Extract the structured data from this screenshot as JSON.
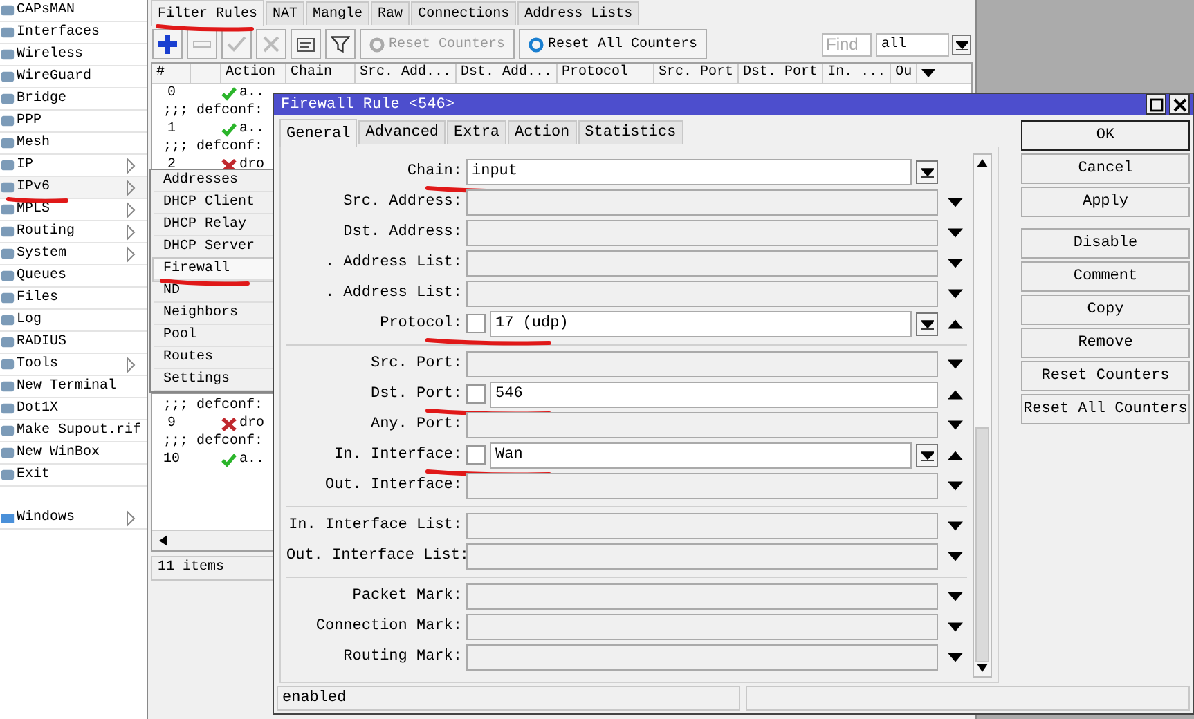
{
  "sidebar": {
    "items": [
      {
        "label": "CAPsMAN",
        "submenu": false,
        "selected": false,
        "underlined": false
      },
      {
        "label": "Interfaces",
        "submenu": false,
        "selected": false,
        "underlined": false
      },
      {
        "label": "Wireless",
        "submenu": false,
        "selected": false,
        "underlined": false
      },
      {
        "label": "WireGuard",
        "submenu": false,
        "selected": false,
        "underlined": false
      },
      {
        "label": "Bridge",
        "submenu": false,
        "selected": false,
        "underlined": false
      },
      {
        "label": "PPP",
        "submenu": false,
        "selected": false,
        "underlined": false
      },
      {
        "label": "Mesh",
        "submenu": false,
        "selected": false,
        "underlined": false
      },
      {
        "label": "IP",
        "submenu": true,
        "selected": false,
        "underlined": false
      },
      {
        "label": "IPv6",
        "submenu": true,
        "selected": true,
        "underlined": true
      },
      {
        "label": "MPLS",
        "submenu": true,
        "selected": false,
        "underlined": false
      },
      {
        "label": "Routing",
        "submenu": true,
        "selected": false,
        "underlined": false
      },
      {
        "label": "System",
        "submenu": true,
        "selected": false,
        "underlined": false
      },
      {
        "label": "Queues",
        "submenu": false,
        "selected": false,
        "underlined": false
      },
      {
        "label": "Files",
        "submenu": false,
        "selected": false,
        "underlined": false
      },
      {
        "label": "Log",
        "submenu": false,
        "selected": false,
        "underlined": false
      },
      {
        "label": "RADIUS",
        "submenu": false,
        "selected": false,
        "underlined": false
      },
      {
        "label": "Tools",
        "submenu": true,
        "selected": false,
        "underlined": false
      },
      {
        "label": "New Terminal",
        "submenu": false,
        "selected": false,
        "underlined": false
      },
      {
        "label": "Dot1X",
        "submenu": false,
        "selected": false,
        "underlined": false
      },
      {
        "label": "Make Supout.rif",
        "submenu": false,
        "selected": false,
        "underlined": false
      },
      {
        "label": "New WinBox",
        "submenu": false,
        "selected": false,
        "underlined": false
      },
      {
        "label": "Exit",
        "submenu": false,
        "selected": false,
        "underlined": false
      }
    ],
    "windows_item": {
      "label": "Windows",
      "submenu": true
    }
  },
  "firewall_window": {
    "tabs": [
      {
        "label": "Filter Rules",
        "selected": true,
        "underlined": true
      },
      {
        "label": "NAT",
        "selected": false,
        "underlined": false
      },
      {
        "label": "Mangle",
        "selected": false,
        "underlined": false
      },
      {
        "label": "Raw",
        "selected": false,
        "underlined": false
      },
      {
        "label": "Connections",
        "selected": false,
        "underlined": false
      },
      {
        "label": "Address Lists",
        "selected": false,
        "underlined": false
      }
    ],
    "toolbar": {
      "icon_buttons": [
        {
          "kind": "add",
          "disabled": false
        },
        {
          "kind": "remove",
          "disabled": true
        },
        {
          "kind": "enable",
          "disabled": true
        },
        {
          "kind": "disable",
          "disabled": true
        },
        {
          "kind": "comment",
          "disabled": false
        },
        {
          "kind": "filter",
          "disabled": false
        }
      ],
      "text_buttons": [
        {
          "label": "Reset Counters",
          "disabled": true
        },
        {
          "label": "Reset All Counters",
          "disabled": false
        }
      ],
      "find": {
        "placeholder": "Find"
      },
      "filter_select": {
        "value": "all"
      }
    },
    "table": {
      "columns": [
        "#",
        "",
        "Action",
        "Chain",
        "Src. Add...",
        "Dst. Add...",
        "Protocol",
        "Src. Port",
        "Dst. Port",
        "In. ...",
        "Ou"
      ],
      "row_groups": [
        [
          {
            "kind": "rule",
            "number": "0",
            "action": "a..",
            "dropped": false
          },
          {
            "kind": "comment",
            "text": ";;; defconf:"
          },
          {
            "kind": "rule",
            "number": "1",
            "action": "a..",
            "dropped": false
          },
          {
            "kind": "comment",
            "text": ";;; defconf:"
          },
          {
            "kind": "rule",
            "number": "2",
            "action": "dro",
            "dropped": true
          }
        ],
        [
          {
            "kind": "comment",
            "text": ";;; defconf:"
          },
          {
            "kind": "rule",
            "number": "9",
            "action": "dro",
            "dropped": true
          },
          {
            "kind": "comment",
            "text": ";;; defconf:"
          },
          {
            "kind": "rule",
            "number": "10",
            "action": "a..",
            "dropped": false
          }
        ]
      ]
    },
    "status_bar": "11 items"
  },
  "submenu": {
    "items": [
      {
        "label": "Addresses",
        "selected": false,
        "underlined": false
      },
      {
        "label": "DHCP Client",
        "selected": false,
        "underlined": false
      },
      {
        "label": "DHCP Relay",
        "selected": false,
        "underlined": false
      },
      {
        "label": "DHCP Server",
        "selected": false,
        "underlined": false
      },
      {
        "label": "Firewall",
        "selected": true,
        "underlined": true
      },
      {
        "label": "ND",
        "selected": false,
        "underlined": false
      },
      {
        "label": "Neighbors",
        "selected": false,
        "underlined": false
      },
      {
        "label": "Pool",
        "selected": false,
        "underlined": false
      },
      {
        "label": "Routes",
        "selected": false,
        "underlined": false
      },
      {
        "label": "Settings",
        "selected": false,
        "underlined": false
      }
    ]
  },
  "dialog": {
    "title": "Firewall Rule <546>",
    "tabs": [
      {
        "label": "General",
        "selected": true
      },
      {
        "label": "Advanced",
        "selected": false
      },
      {
        "label": "Extra",
        "selected": false
      },
      {
        "label": "Action",
        "selected": false
      },
      {
        "label": "Statistics",
        "selected": false
      }
    ],
    "field_groups": [
      [
        {
          "label": "Chain:",
          "value": "input",
          "combo": true,
          "underlined": true
        },
        {
          "label": "Src. Address:",
          "combo": false,
          "collapsed": true,
          "underlined": false
        },
        {
          "label": "Dst. Address:",
          "combo": false,
          "collapsed": true,
          "underlined": false
        },
        {
          "label": ". Address List:",
          "combo": false,
          "collapsed": true,
          "underlined": false
        },
        {
          "label": ". Address List:",
          "combo": false,
          "collapsed": true,
          "underlined": false
        },
        {
          "label": "Protocol:",
          "value": "17 (udp)",
          "negated": false,
          "combo": true,
          "collapsed": false,
          "underlined": true
        }
      ],
      [
        {
          "label": "Src. Port:",
          "combo": false,
          "collapsed": true,
          "underlined": false
        },
        {
          "label": "Dst. Port:",
          "value": "546",
          "negated": false,
          "combo": false,
          "collapsed": false,
          "underlined": true
        },
        {
          "label": "Any. Port:",
          "combo": false,
          "collapsed": true,
          "underlined": false
        },
        {
          "label": "In. Interface:",
          "value": "Wan",
          "negated": false,
          "combo": true,
          "collapsed": false,
          "underlined": true
        },
        {
          "label": "Out. Interface:",
          "combo": false,
          "collapsed": true,
          "underlined": false
        }
      ],
      [
        {
          "label": "In. Interface List:",
          "combo": false,
          "collapsed": true,
          "underlined": false
        },
        {
          "label": "Out. Interface List:",
          "combo": false,
          "collapsed": true,
          "underlined": false
        }
      ],
      [
        {
          "label": "Packet Mark:",
          "combo": false,
          "collapsed": true,
          "underlined": false
        },
        {
          "label": "Connection Mark:",
          "combo": false,
          "collapsed": true,
          "underlined": false
        },
        {
          "label": "Routing Mark:",
          "combo": false,
          "collapsed": true,
          "underlined": false
        }
      ]
    ],
    "button_groups": [
      [
        {
          "label": "OK",
          "default": true
        },
        {
          "label": "Cancel",
          "default": false
        },
        {
          "label": "Apply",
          "default": false
        }
      ],
      [
        {
          "label": "Disable",
          "default": false
        },
        {
          "label": "Comment",
          "default": false
        },
        {
          "label": "Copy",
          "default": false
        },
        {
          "label": "Remove",
          "default": false
        },
        {
          "label": "Reset Counters",
          "default": false
        },
        {
          "label": "Reset All Counters",
          "default": false
        }
      ]
    ],
    "status_bar": [
      "enabled"
    ]
  }
}
